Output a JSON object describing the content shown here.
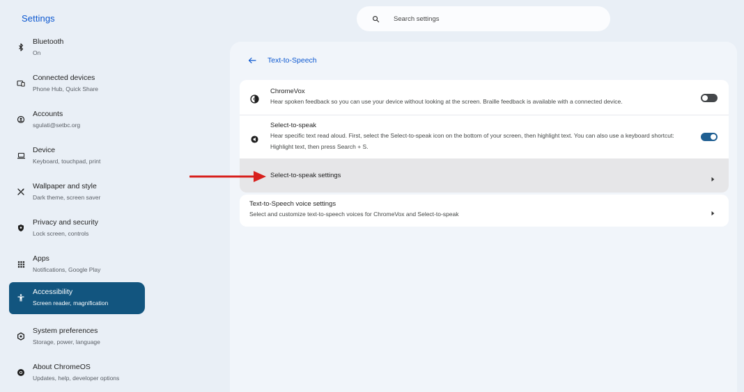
{
  "app": {
    "title": "Settings"
  },
  "search": {
    "placeholder": "Search settings"
  },
  "sidebar": {
    "items": [
      {
        "label": "Bluetooth",
        "sublabel": "On",
        "icon": "bluetooth-icon"
      },
      {
        "label": "Connected devices",
        "sublabel": "Phone Hub, Quick Share",
        "icon": "connected-devices-icon"
      },
      {
        "label": "Accounts",
        "sublabel": "sgulati@setbc.org",
        "icon": "accounts-icon"
      },
      {
        "label": "Device",
        "sublabel": "Keyboard, touchpad, print",
        "icon": "laptop-icon"
      },
      {
        "label": "Wallpaper and style",
        "sublabel": "Dark theme, screen saver",
        "icon": "wallpaper-icon"
      },
      {
        "label": "Privacy and security",
        "sublabel": "Lock screen, controls",
        "icon": "shield-icon"
      },
      {
        "label": "Apps",
        "sublabel": "Notifications, Google Play",
        "icon": "apps-grid-icon"
      },
      {
        "label": "Accessibility",
        "sublabel": "Screen reader, magnification",
        "icon": "accessibility-icon",
        "active": true
      },
      {
        "label": "System preferences",
        "sublabel": "Storage, power, language",
        "icon": "system-preferences-icon"
      },
      {
        "label": "About ChromeOS",
        "sublabel": "Updates, help, developer options",
        "icon": "chrome-icon"
      }
    ]
  },
  "main": {
    "title": "Text-to-Speech",
    "chromevox": {
      "title": "ChromeVox",
      "description": "Hear spoken feedback so you can use your device without looking at the screen. Braille feedback is available with a connected device.",
      "enabled": false
    },
    "select_to_speak": {
      "title": "Select-to-speak",
      "description": "Hear specific text read aloud. First, select the Select-to-speak icon on the bottom of your screen, then highlight text. You can also use a keyboard shortcut: Highlight text, then press Search + S.",
      "enabled": true
    },
    "select_to_speak_settings": {
      "label": "Select-to-speak settings"
    },
    "voice_settings": {
      "title": "Text-to-Speech voice settings",
      "description": "Select and customize text-to-speech voices for ChromeVox and Select-to-speak"
    }
  },
  "colors": {
    "accent": "#0b57d0",
    "active_nav": "#12557f",
    "toggle_on": "#1f5f92",
    "annotation_arrow": "#d8201c"
  }
}
